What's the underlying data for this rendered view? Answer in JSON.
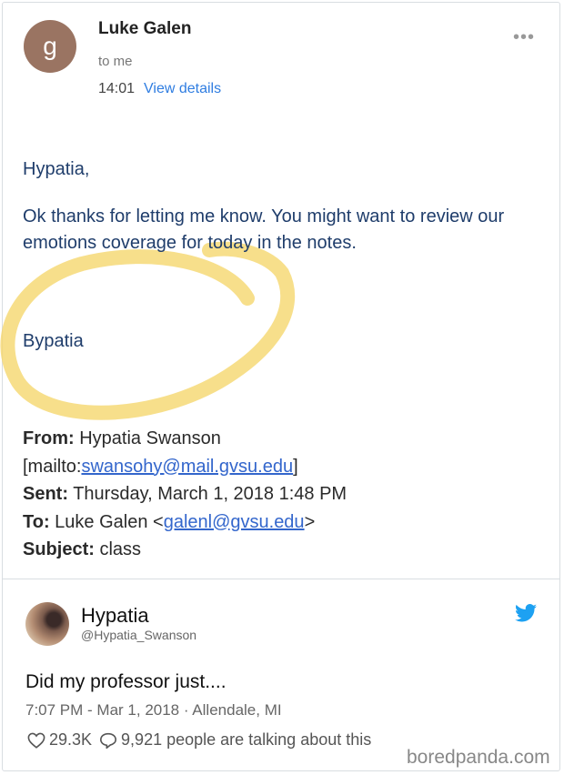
{
  "email": {
    "avatar_letter": "g",
    "sender": "Luke Galen",
    "recipient": "to me",
    "time": "14:01",
    "view_details": "View details",
    "more": "•••",
    "greeting": "Hypatia,",
    "message": "Ok thanks for letting me know. You might want to review our emotions coverage for today in the notes.",
    "signoff": "Bypatia",
    "quoted": {
      "from_label": "From:",
      "from_name": "Hypatia Swanson",
      "mailto_prefix": "[mailto:",
      "from_email": "swansohy@mail.gvsu.edu",
      "mailto_suffix": "]",
      "sent_label": "Sent:",
      "sent_value": "Thursday, March 1, 2018 1:48 PM",
      "to_label": "To:",
      "to_name": "Luke Galen <",
      "to_email": "galenl@gvsu.edu",
      "to_suffix": ">",
      "subject_label": "Subject:",
      "subject_value": "class"
    }
  },
  "tweet": {
    "name": "Hypatia",
    "handle": "@Hypatia_Swanson",
    "text": "Did my professor just....",
    "meta": "7:07 PM - Mar 1, 2018 · Allendale, MI",
    "likes": "29.3K",
    "replies": "9,921 people are talking about this"
  },
  "watermark": "boredpanda.com",
  "colors": {
    "highlight": "#f5d76e",
    "link": "#3366cc",
    "twitter": "#1da1f2",
    "avatar": "#9a7462"
  },
  "icons": [
    "more-icon",
    "twitter-bird-icon",
    "heart-icon",
    "reply-bubble-icon"
  ]
}
